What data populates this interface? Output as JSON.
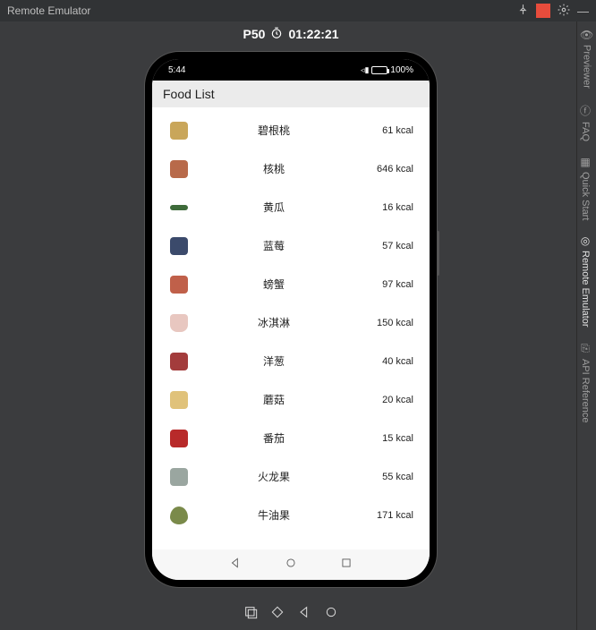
{
  "ide": {
    "title": "Remote Emulator",
    "topIcons": {
      "pin": "📌",
      "gear": "✶",
      "minimize": "—"
    }
  },
  "sideTabs": [
    {
      "icon": "👁",
      "label": "Previewer"
    },
    {
      "icon": "ⓕ",
      "label": "FAQ"
    },
    {
      "icon": "▦",
      "label": "Quick Start"
    },
    {
      "icon": "◎",
      "label": "Remote Emulator"
    },
    {
      "icon": "⎘",
      "label": "API Reference"
    }
  ],
  "emulator": {
    "device": "P50",
    "timer": "01:22:21"
  },
  "statusBar": {
    "time": "5:44",
    "battery": "100%"
  },
  "app": {
    "title": "Food List"
  },
  "foods": [
    {
      "name": "碧根桃",
      "kcal": "61 kcal",
      "color": "#c9a65a"
    },
    {
      "name": "核桃",
      "kcal": "646 kcal",
      "color": "#b86a4a"
    },
    {
      "name": "黄瓜",
      "kcal": "16 kcal",
      "color": "#3e6b3a"
    },
    {
      "name": "蓝莓",
      "kcal": "57 kcal",
      "color": "#3b4a6b"
    },
    {
      "name": "螃蟹",
      "kcal": "97 kcal",
      "color": "#c0604a"
    },
    {
      "name": "冰淇淋",
      "kcal": "150 kcal",
      "color": "#e8c7c0"
    },
    {
      "name": "洋葱",
      "kcal": "40 kcal",
      "color": "#a33c3c"
    },
    {
      "name": "蘑菇",
      "kcal": "20 kcal",
      "color": "#e0c27a"
    },
    {
      "name": "番茄",
      "kcal": "15 kcal",
      "color": "#b82a2a"
    },
    {
      "name": "火龙果",
      "kcal": "55 kcal",
      "color": "#9aa6a0"
    },
    {
      "name": "牛油果",
      "kcal": "171 kcal",
      "color": "#7a8a4a"
    }
  ]
}
